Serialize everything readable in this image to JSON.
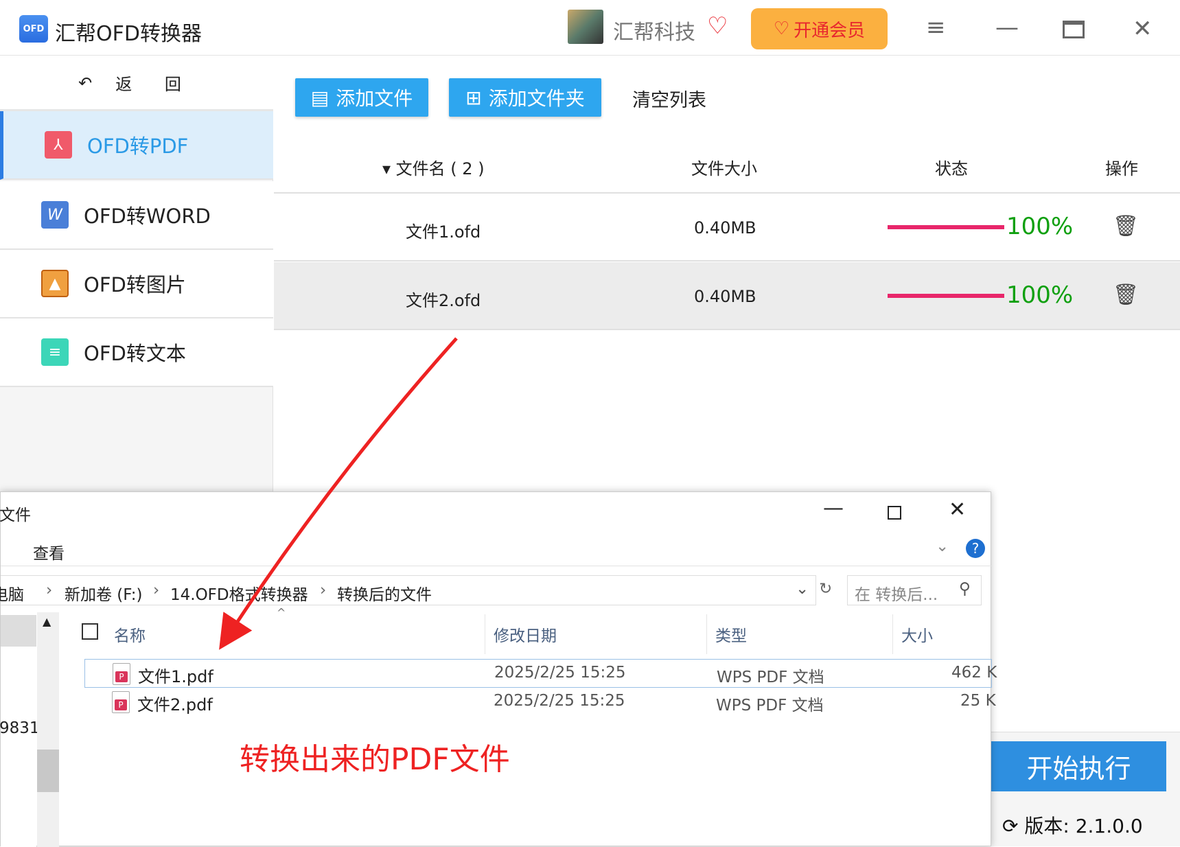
{
  "app": {
    "logo_text": "OFD",
    "title": "汇帮OFD转换器",
    "brand": "汇帮科技",
    "vip_label": "开通会员"
  },
  "sidebar": {
    "back_label": "返 回",
    "items": [
      {
        "label": "OFD转PDF",
        "icon": "pdf-icon",
        "active": true
      },
      {
        "label": "OFD转WORD",
        "icon": "word-icon"
      },
      {
        "label": "OFD转图片",
        "icon": "image-icon"
      },
      {
        "label": "OFD转文本",
        "icon": "text-icon"
      }
    ]
  },
  "toolbar": {
    "add_file": "添加文件",
    "add_folder": "添加文件夹",
    "clear_list": "清空列表"
  },
  "table": {
    "headers": [
      "▾ 文件名 ( 2 )",
      "文件大小",
      "状态",
      "操作"
    ],
    "rows": [
      {
        "name": "文件1.ofd",
        "size": "0.40MB",
        "progress": 100,
        "progress_label": "100%"
      },
      {
        "name": "文件2.ofd",
        "size": "0.40MB",
        "progress": 100,
        "progress_label": "100%"
      }
    ]
  },
  "dialog": {
    "title_fragment": "文件",
    "menu_view": "查看",
    "breadcrumb": [
      "电脑",
      "新加卷 (F:)",
      "14.OFD格式转换器",
      "转换后的文件"
    ],
    "search_placeholder": "在 转换后...",
    "nav_fragment": "9831",
    "columns": [
      "名称",
      "修改日期",
      "类型",
      "大小"
    ],
    "files": [
      {
        "name": "文件1.pdf",
        "date": "2025/2/25 15:25",
        "type": "WPS PDF 文档",
        "size": "462 K"
      },
      {
        "name": "文件2.pdf",
        "date": "2025/2/25 15:25",
        "type": "WPS PDF 文档",
        "size": "25 K"
      }
    ]
  },
  "annotation": "转换出来的PDF文件",
  "start_button": "开始执行",
  "version": "版本:  2.1.0.0",
  "colors": {
    "accent": "#2ea6ef",
    "progress": "#e8266a",
    "percent": "#10a010",
    "annotation": "#ee2222"
  }
}
